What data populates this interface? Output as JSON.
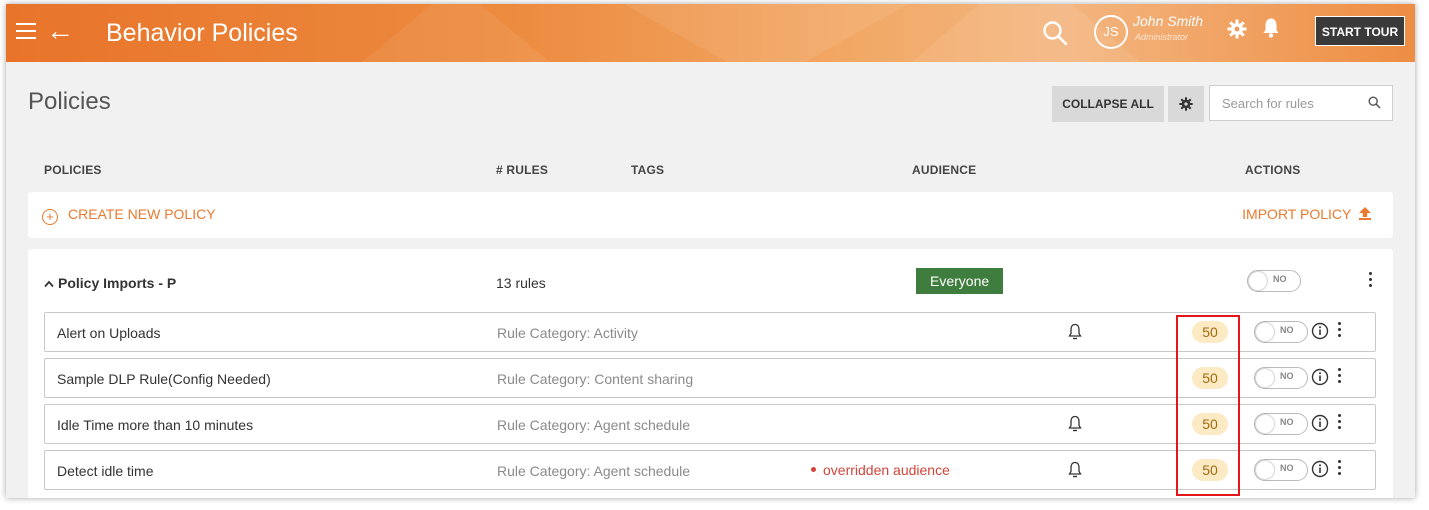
{
  "header": {
    "title": "Behavior Policies",
    "user": {
      "initials": "JS",
      "name": "John Smith",
      "role": "Administrator"
    },
    "start_tour_label": "START TOUR"
  },
  "toolbar": {
    "page_title": "Policies",
    "collapse_all_label": "COLLAPSE ALL",
    "search_placeholder": "Search for rules"
  },
  "columns": {
    "policies": "POLICIES",
    "rules": "# RULES",
    "tags": "TAGS",
    "audience": "AUDIENCE",
    "actions": "ACTIONS"
  },
  "create_new_policy_label": "CREATE NEW POLICY",
  "import_policy_label": "IMPORT POLICY",
  "policy_group": {
    "name": "Policy Imports - P",
    "rules_count": "13 rules",
    "audience": "Everyone",
    "toggle_label": "NO",
    "rules": [
      {
        "name": "Alert on Uploads",
        "category": "Rule Category: Activity",
        "override": "",
        "has_alert": true,
        "score": "50",
        "toggle_label": "NO"
      },
      {
        "name": "Sample DLP Rule(Config Needed)",
        "category": "Rule Category: Content sharing",
        "override": "",
        "has_alert": false,
        "score": "50",
        "toggle_label": "NO"
      },
      {
        "name": "Idle Time more than 10 minutes",
        "category": "Rule Category: Agent schedule",
        "override": "",
        "has_alert": true,
        "score": "50",
        "toggle_label": "NO"
      },
      {
        "name": "Detect idle time",
        "category": "Rule Category: Agent schedule",
        "override": "overridden audience",
        "has_alert": true,
        "score": "50",
        "toggle_label": "NO"
      }
    ]
  },
  "colors": {
    "accent": "#e97a2f",
    "audience_badge": "#3f7d3f",
    "score_badge": "#fbeac3",
    "override_text": "#d2453a",
    "highlight_box": "#e3161a"
  },
  "icons": [
    "hamburger-icon",
    "back-arrow-icon",
    "search-icon",
    "gear-icon",
    "bell-icon",
    "upload-icon",
    "plus-circle-icon",
    "chevron-up-icon",
    "info-icon",
    "kebab-icon"
  ]
}
